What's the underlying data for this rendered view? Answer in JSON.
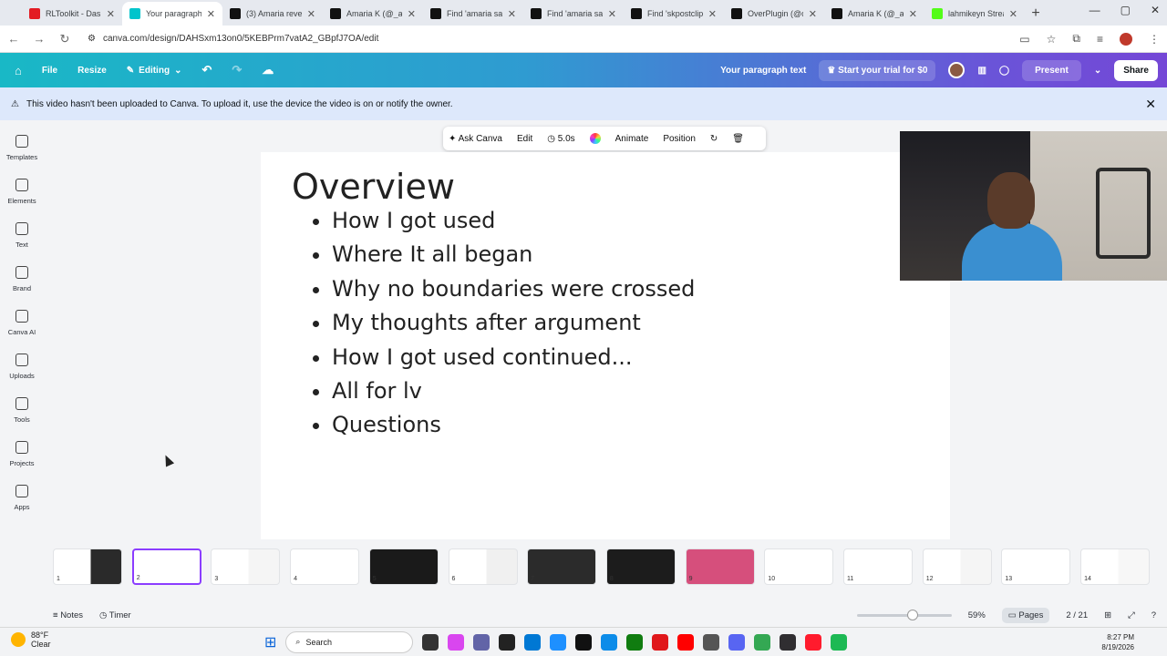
{
  "browser": {
    "tabs": [
      {
        "title": "RLToolkit - Dashb",
        "color": "#e31b23"
      },
      {
        "title": "Your paragraph te",
        "color": "#00c4cc",
        "active": true
      },
      {
        "title": "(3) Amaria reveals",
        "color": "#111111"
      },
      {
        "title": "Amaria K (@_ama",
        "color": "#111111"
      },
      {
        "title": "Find 'amaria says",
        "color": "#111111"
      },
      {
        "title": "Find 'amaria says",
        "color": "#111111"
      },
      {
        "title": "Find 'skpostclips",
        "color": "#111111"
      },
      {
        "title": "OverPlugin (@ove",
        "color": "#111111"
      },
      {
        "title": "Amaria K (@_ama",
        "color": "#111111"
      },
      {
        "title": "lahmikeyn Stream",
        "color": "#53fc18"
      }
    ],
    "url": "canva.com/design/DAHSxm13on0/5KEBPrm7vatA2_GBpfJ7OA/edit"
  },
  "canva": {
    "home": "⌂",
    "file": "File",
    "resize": "Resize",
    "editing": "Editing",
    "doc_title": "Your paragraph text",
    "trial": "Start your trial for $0",
    "present": "Present",
    "share": "Share"
  },
  "notice": {
    "text": "This video hasn't been uploaded to Canva. To upload it, use the device the video is on or notify the owner."
  },
  "sidebar": [
    {
      "label": "Templates",
      "icon": "templates-icon"
    },
    {
      "label": "Elements",
      "icon": "elements-icon"
    },
    {
      "label": "Text",
      "icon": "text-icon"
    },
    {
      "label": "Brand",
      "icon": "brand-icon"
    },
    {
      "label": "Canva AI",
      "icon": "canva-ai-icon"
    },
    {
      "label": "Uploads",
      "icon": "uploads-icon"
    },
    {
      "label": "Tools",
      "icon": "tools-icon"
    },
    {
      "label": "Projects",
      "icon": "projects-icon"
    },
    {
      "label": "Apps",
      "icon": "apps-icon"
    }
  ],
  "context_toolbar": {
    "ask": "Ask Canva",
    "edit": "Edit",
    "duration": "5.0s",
    "animate": "Animate",
    "position": "Position"
  },
  "slide": {
    "title": "Overview",
    "bullets": [
      "How I got used",
      "Where It all began",
      "Why no boundaries were crossed",
      "My thoughts after argument",
      "How I got used continued...",
      "All for lv",
      "Questions"
    ]
  },
  "thumbnails": [
    "1",
    "2",
    "3",
    "4",
    "5",
    "6",
    "7",
    "8",
    "9",
    "10",
    "11",
    "12",
    "13",
    "14"
  ],
  "footer": {
    "notes": "Notes",
    "timer": "Timer",
    "zoom": "59%",
    "zoom_level": 0.59,
    "pages": "Pages",
    "page_count": "2 / 21"
  },
  "taskbar": {
    "temp": "88°F",
    "weather": "Clear",
    "search": "Search",
    "time": "8:27 PM",
    "date": "8/19/2026"
  }
}
